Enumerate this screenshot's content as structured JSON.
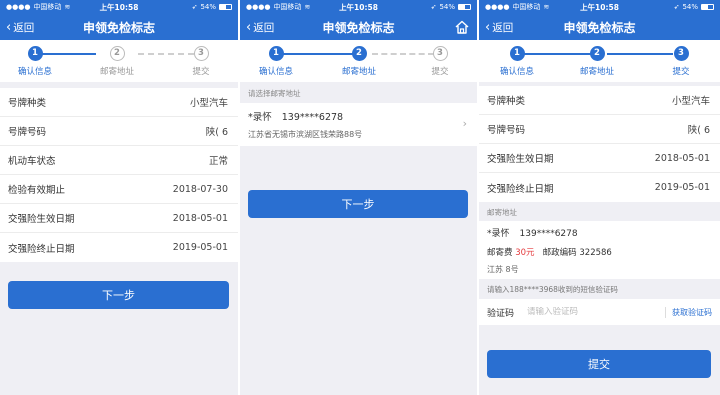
{
  "status": {
    "carrier": "中国移动",
    "time": "上午10:58",
    "battery": "54%"
  },
  "nav": {
    "title": "申领免检标志",
    "back": "返回"
  },
  "steps": [
    {
      "num": "1",
      "label": "确认信息"
    },
    {
      "num": "2",
      "label": "邮寄地址"
    },
    {
      "num": "3",
      "label": "提交"
    }
  ],
  "vehicle": [
    {
      "key": "号牌种类",
      "value": "小型汽车"
    },
    {
      "key": "号牌号码",
      "value": "陕(    6"
    },
    {
      "key": "机动车状态",
      "value": "正常"
    },
    {
      "key": "检验有效期止",
      "value": "2018-07-30"
    },
    {
      "key": "交强险生效日期",
      "value": "2018-05-01"
    },
    {
      "key": "交强险终止日期",
      "value": "2019-05-01"
    }
  ],
  "panel3_rows": [
    {
      "key": "号牌种类",
      "value": "小型汽车"
    },
    {
      "key": "号牌号码",
      "value": "陕(    6"
    },
    {
      "key": "交强险生效日期",
      "value": "2018-05-01"
    },
    {
      "key": "交强险终止日期",
      "value": "2019-05-01"
    }
  ],
  "buttons": {
    "next": "下一步",
    "submit": "提交"
  },
  "address": {
    "section_label": "请选择邮寄地址",
    "name": "*录怀",
    "phone": "139****6278",
    "line": "江苏省无锡市滨湖区钱荣路88号"
  },
  "mail": {
    "section_label": "邮寄地址",
    "name": "*录怀",
    "phone": "139****6278",
    "fee_label": "邮寄费",
    "fee_value": "30元",
    "postcode_label": "邮政编码",
    "postcode": "322586",
    "address": "江苏                  8号"
  },
  "sms": {
    "hint": "请输入188****3968收到的短信验证码",
    "label": "验证码",
    "placeholder": "请输入验证码",
    "get_code": "获取验证码"
  },
  "colors": {
    "primary": "#2a6fd1",
    "fee": "#e4393c"
  }
}
